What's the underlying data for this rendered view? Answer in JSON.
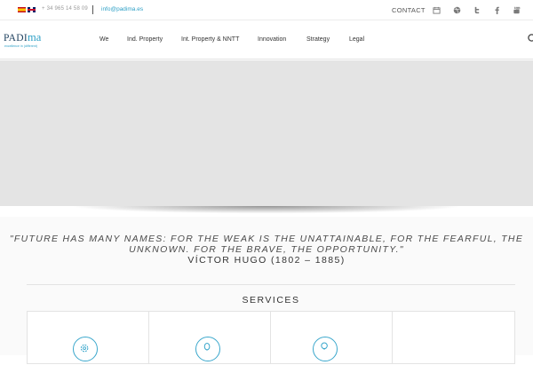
{
  "topbar": {
    "languages": [
      "Español",
      "English"
    ],
    "phone": "+ 34 965 14 58 09",
    "email": "info@padima.es",
    "contact_label": "CONTACT",
    "icons": [
      "calendar-icon",
      "dribbble-icon",
      "twitter-icon",
      "facebook-icon",
      "youtube-icon"
    ]
  },
  "header": {
    "logo_prefix": "PADI",
    "logo_suffix": "ma",
    "logo_tagline": "excellence in (different)",
    "menu": [
      "We",
      "Ind. Property",
      "Int. Property & NNTT",
      "Innovation",
      "Strategy",
      "Legal"
    ]
  },
  "quote": {
    "text": "\"FUTURE HAS MANY NAMES: FOR THE WEAK IS THE UNATTAINABLE, FOR THE FEARFUL, THE UNKNOWN. FOR THE BRAVE, THE OPPORTUNITY.\"",
    "author": "VÍCTOR HUGO (1802 – 1885)"
  },
  "services": {
    "title": "SERVICES",
    "card_icons": [
      "gear-icon",
      "bulb-icon",
      "bulb-icon"
    ]
  },
  "colors": {
    "accent": "#2ea0c6",
    "hero": "#e4e4e4",
    "text": "#333333"
  }
}
